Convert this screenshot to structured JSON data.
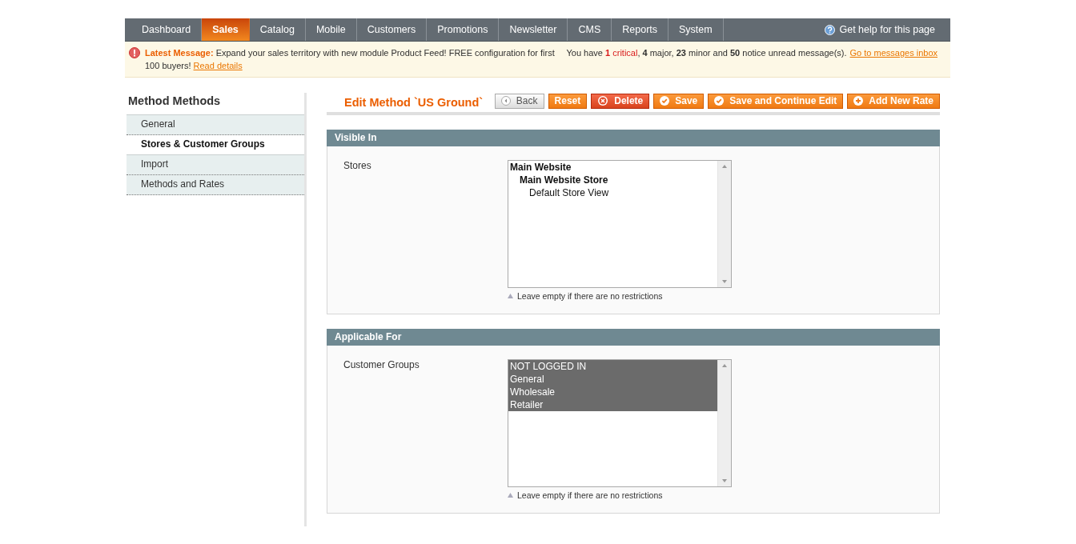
{
  "nav": {
    "items": [
      {
        "label": "Dashboard",
        "selected": false
      },
      {
        "label": "Sales",
        "selected": true
      },
      {
        "label": "Catalog",
        "selected": false
      },
      {
        "label": "Mobile",
        "selected": false
      },
      {
        "label": "Customers",
        "selected": false
      },
      {
        "label": "Promotions",
        "selected": false
      },
      {
        "label": "Newsletter",
        "selected": false
      },
      {
        "label": "CMS",
        "selected": false
      },
      {
        "label": "Reports",
        "selected": false
      },
      {
        "label": "System",
        "selected": false
      }
    ],
    "help": "Get help for this page"
  },
  "message": {
    "label": "Latest Message:",
    "text": "Expand your sales territory with new module Product Feed! FREE configuration for first 100 buyers!",
    "link": "Read details",
    "notice": [
      {
        "kind": "text",
        "text": "You have "
      },
      {
        "kind": "critical-count",
        "text": "1"
      },
      {
        "kind": "critical",
        "text": " critical"
      },
      {
        "kind": "text",
        "text": ", "
      },
      {
        "kind": "count",
        "text": "4"
      },
      {
        "kind": "text",
        "text": " major, "
      },
      {
        "kind": "count",
        "text": "23"
      },
      {
        "kind": "text",
        "text": " minor and "
      },
      {
        "kind": "count",
        "text": "50"
      },
      {
        "kind": "text",
        "text": " notice unread message(s)."
      }
    ],
    "inbox_link": "Go to messages inbox"
  },
  "sidebar": {
    "title": "Method Methods",
    "items": [
      {
        "label": "General",
        "selected": false
      },
      {
        "label": "Stores & Customer Groups",
        "selected": true
      },
      {
        "label": "Import",
        "selected": false
      },
      {
        "label": "Methods and Rates",
        "selected": false
      }
    ]
  },
  "page": {
    "title": "Edit Method `US Ground`",
    "buttons": [
      {
        "label": "Back",
        "kind": "back"
      },
      {
        "label": "Reset",
        "kind": "reset"
      },
      {
        "label": "Delete",
        "kind": "delete"
      },
      {
        "label": "Save",
        "kind": "save"
      },
      {
        "label": "Save and Continue Edit",
        "kind": "save"
      },
      {
        "label": "Add New Rate",
        "kind": "add"
      }
    ]
  },
  "fieldsets": [
    {
      "title": "Visible In",
      "label": "Stores",
      "hint": "Leave empty if there are no restrictions",
      "options": [
        {
          "label": "Main Website",
          "selected": false,
          "children": [
            {
              "label": "Main Website Store",
              "selected": false,
              "children": [
                {
                  "label": "Default Store View",
                  "selected": false
                }
              ]
            }
          ]
        }
      ]
    },
    {
      "title": "Applicable For",
      "label": "Customer Groups",
      "hint": "Leave empty if there are no restrictions",
      "options": [
        {
          "label": "NOT LOGGED IN",
          "selected": true
        },
        {
          "label": "General",
          "selected": true
        },
        {
          "label": "Wholesale",
          "selected": true
        },
        {
          "label": "Retailer",
          "selected": true
        }
      ]
    }
  ]
}
